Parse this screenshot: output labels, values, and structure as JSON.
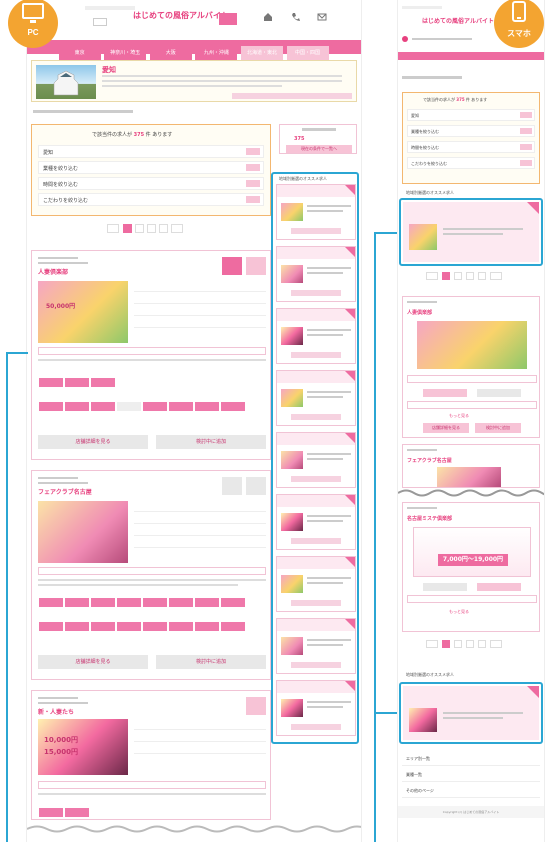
{
  "badges": {
    "pc": "PC",
    "sp": "スマホ"
  },
  "pc": {
    "logo": "はじめての風俗アルバイト",
    "nav": [
      "",
      "東京",
      "神奈川・埼玉",
      "大阪",
      "九州・沖縄",
      "北海道・東北",
      "中国・四国"
    ],
    "region_title": "愛知",
    "count_text": "で該当件の求人が",
    "count_num": "375",
    "count_suffix": "件 あります",
    "search_rows": [
      "愛知",
      "業種を絞り込む",
      "時間を絞り込む",
      "こだわりを絞り込む"
    ],
    "side_count": "375",
    "side_button": "現在の条件で一覧へ",
    "side_rec_title": "地域別厳選のオススメ求人",
    "shops": [
      {
        "name": "人妻倶楽部"
      },
      {
        "name": "フェアクラブ名古屋"
      },
      {
        "name": "新・人妻たち"
      }
    ],
    "detail_btn": "店舗詳細を見る",
    "keep_btn": "検討中に追加",
    "promo_text_1": "50,000円",
    "promo_text_2": "10,000円",
    "promo_text_3": "15,000円"
  },
  "sp": {
    "logo": "はじめての風俗アルバイト",
    "count_text": "で該当件の求人が",
    "count_num": "375",
    "count_suffix": "件 あります",
    "search_rows": [
      "愛知",
      "業種を絞り込む",
      "時間を絞り込む",
      "こだわりを絞り込む"
    ],
    "rec_title": "地域別厳選のオススメ求人",
    "shops": [
      {
        "name": "人妻倶楽部"
      },
      {
        "name": "フェアクラブ名古屋"
      },
      {
        "name": "名古屋ミステ倶楽部"
      }
    ],
    "salary": "7,000円〜19,000円",
    "more": "もっと見る",
    "detail_btn": "店舗詳細を見る",
    "keep_btn": "検討中に追加",
    "footer_rows": [
      "エリア別一覧",
      "業種一覧",
      "その他のページ"
    ],
    "copyright": "Copyright (c) はじめての風俗アルバイト"
  }
}
